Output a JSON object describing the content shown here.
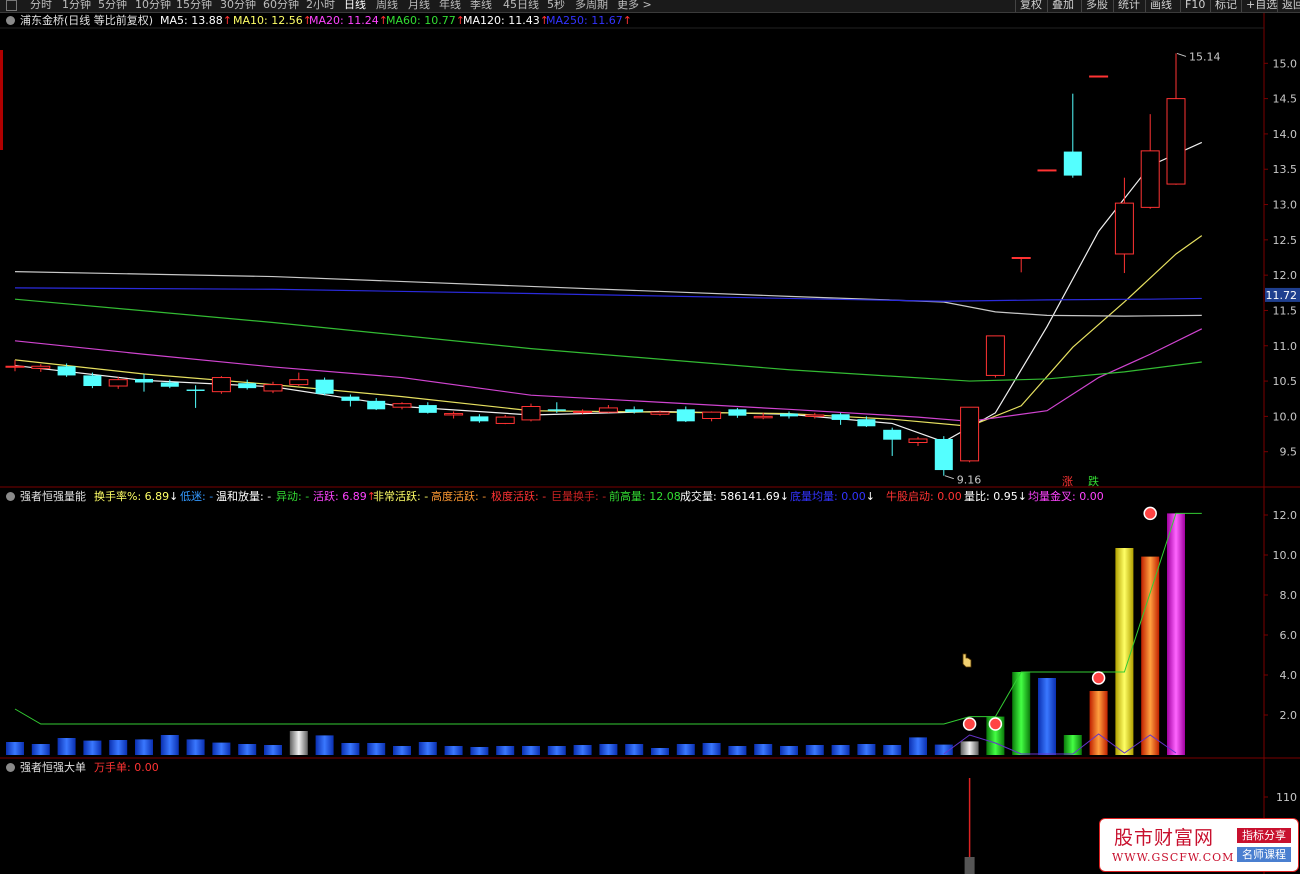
{
  "topbar": {
    "left_items": [
      "分时",
      "1分钟",
      "5分钟",
      "10分钟",
      "15分钟",
      "30分钟",
      "60分钟",
      "2小时",
      "日线",
      "周线",
      "月线",
      "年线",
      "季线",
      "45日线",
      "5秒",
      "多周期",
      "更多 >"
    ],
    "active_index": 8,
    "right_items": [
      "复权",
      "叠加",
      "多股",
      "统计",
      "画线",
      "F10",
      "标记",
      "+自选",
      "返回"
    ]
  },
  "main_legend": {
    "title": "浦东金桥(日线 等比前复权)",
    "items": [
      {
        "label": "MA5: 13.88",
        "arrow": "↑",
        "color": "#ffffff"
      },
      {
        "label": "MA10: 12.56",
        "arrow": "↑",
        "color": "#ffff66"
      },
      {
        "label": "MA20: 11.24",
        "arrow": "↑",
        "color": "#ff44ff"
      },
      {
        "label": "MA60: 10.77",
        "arrow": "↑",
        "color": "#33dd33"
      },
      {
        "label": "MA120: 11.43",
        "arrow": "↑",
        "color": "#ffffff"
      },
      {
        "label": "MA250: 11.67",
        "arrow": "↑",
        "color": "#3333ff"
      }
    ],
    "arrow_color": "#ff3333"
  },
  "vol_legend": {
    "title": "强者恒强量能",
    "items": [
      {
        "label": "换手率%: 6.89",
        "arrow": "↓",
        "color": "#ffff66",
        "arrow_color": "#ffffff"
      },
      {
        "label": "低迷: -",
        "color": "#3399ff"
      },
      {
        "label": "温和放量: -",
        "color": "#ffffff"
      },
      {
        "label": "异动: -",
        "color": "#33dd33"
      },
      {
        "label": "活跃: 6.89",
        "arrow": "↑",
        "color": "#ff44ff",
        "arrow_color": "#ff3333"
      },
      {
        "label": "非常活跃: -",
        "color": "#ffff66"
      },
      {
        "label": "高度活跃: -",
        "color": "#ff9933"
      },
      {
        "label": "极度活跃: -",
        "color": "#ff3333"
      },
      {
        "label": "巨量换手: -",
        "color": "#cc2222"
      },
      {
        "label": "前高量: 12.08",
        "color": "#33dd33"
      },
      {
        "label": "成交量: 586141.69",
        "arrow": "↓",
        "color": "#ffffff",
        "arrow_color": "#ffffff"
      },
      {
        "label": "底量均量: 0.00",
        "arrow": "↓",
        "color": "#3333ff",
        "arrow_color": "#ffffff"
      },
      {
        "label": "牛股启动: 0.00",
        "color": "#ff3333"
      },
      {
        "label": "量比: 0.95",
        "arrow": "↓",
        "color": "#ffffff",
        "arrow_color": "#ffffff"
      },
      {
        "label": "均量金叉: 0.00",
        "color": "#ff44ff"
      }
    ]
  },
  "big_legend": {
    "title": "强者恒强大单",
    "items": [
      {
        "label": "万手单: 0.00",
        "color": "#ff3333"
      }
    ]
  },
  "watermark": {
    "title": "股市财富网",
    "url": "WWW.GSCFW.COM",
    "tag1": "指标分享",
    "tag2": "名师课程"
  },
  "colors": {
    "up": "#ff3333",
    "down": "#54ffff",
    "axis": "#7a0000",
    "grid": "#333333"
  },
  "chart_data": [
    {
      "type": "candlestick",
      "title": "浦东金桥(日线 等比前复权)",
      "ylim": [
        9.0,
        15.5
      ],
      "yticks": [
        9.5,
        10.0,
        10.5,
        11.0,
        11.5,
        12.0,
        12.5,
        13.0,
        13.5,
        14.0,
        14.5,
        15.0
      ],
      "current_price": "11.72",
      "annotations": {
        "high": "15.14",
        "low": "9.16",
        "rise_label": "涨",
        "fall_label": "跌"
      },
      "candles": [
        [
          10.71,
          10.71,
          10.8,
          10.64
        ],
        [
          10.68,
          10.71,
          10.74,
          10.63
        ],
        [
          10.71,
          10.58,
          10.75,
          10.56
        ],
        [
          10.58,
          10.43,
          10.62,
          10.4
        ],
        [
          10.43,
          10.52,
          10.56,
          10.39
        ],
        [
          10.53,
          10.48,
          10.6,
          10.35
        ],
        [
          10.48,
          10.42,
          10.52,
          10.4
        ],
        [
          10.38,
          10.36,
          10.44,
          10.12
        ],
        [
          10.35,
          10.55,
          10.57,
          10.32
        ],
        [
          10.47,
          10.4,
          10.52,
          10.38
        ],
        [
          10.36,
          10.45,
          10.49,
          10.33
        ],
        [
          10.45,
          10.52,
          10.62,
          10.43
        ],
        [
          10.52,
          10.32,
          10.55,
          10.3
        ],
        [
          10.28,
          10.22,
          10.31,
          10.14
        ],
        [
          10.22,
          10.1,
          10.26,
          10.09
        ],
        [
          10.13,
          10.18,
          10.2,
          10.1
        ],
        [
          10.16,
          10.05,
          10.2,
          10.04
        ],
        [
          10.02,
          10.04,
          10.07,
          9.97
        ],
        [
          10.0,
          9.93,
          10.03,
          9.91
        ],
        [
          9.9,
          9.99,
          10.02,
          9.89
        ],
        [
          9.95,
          10.14,
          10.18,
          9.93
        ],
        [
          10.1,
          10.08,
          10.2,
          10.05
        ],
        [
          10.06,
          10.07,
          10.1,
          10.03
        ],
        [
          10.06,
          10.12,
          10.16,
          10.05
        ],
        [
          10.1,
          10.06,
          10.14,
          10.04
        ],
        [
          10.03,
          10.06,
          10.08,
          10.01
        ],
        [
          10.1,
          9.93,
          10.14,
          9.92
        ],
        [
          9.97,
          10.06,
          10.07,
          9.93
        ],
        [
          10.1,
          10.01,
          10.12,
          9.98
        ],
        [
          9.98,
          10.0,
          10.05,
          9.96
        ],
        [
          10.04,
          10.0,
          10.07,
          9.97
        ],
        [
          10.0,
          10.02,
          10.05,
          9.97
        ],
        [
          10.03,
          9.95,
          10.05,
          9.88
        ],
        [
          9.96,
          9.86,
          10.0,
          9.85
        ],
        [
          9.81,
          9.67,
          9.84,
          9.44
        ],
        [
          9.63,
          9.68,
          9.71,
          9.58
        ],
        [
          9.68,
          9.24,
          9.72,
          9.16
        ],
        [
          9.37,
          10.13,
          10.13,
          9.35
        ],
        [
          10.58,
          11.14,
          11.14,
          10.55
        ],
        [
          12.25,
          12.25,
          12.25,
          12.04
        ],
        [
          13.49,
          13.49,
          13.49,
          13.49
        ],
        [
          13.75,
          13.41,
          14.57,
          13.38
        ],
        [
          14.82,
          14.82,
          14.82,
          14.82
        ],
        [
          12.3,
          13.02,
          13.38,
          12.03
        ],
        [
          12.96,
          13.76,
          14.28,
          12.94
        ],
        [
          13.29,
          14.5,
          15.14,
          13.28
        ]
      ],
      "ma": {
        "MA5": [
          [
            0,
            10.72
          ],
          [
            5,
            10.51
          ],
          [
            10,
            10.42
          ],
          [
            15,
            10.14
          ],
          [
            20,
            10.02
          ],
          [
            25,
            10.07
          ],
          [
            30,
            10.03
          ],
          [
            34,
            9.9
          ],
          [
            36,
            9.64
          ],
          [
            38,
            10.05
          ],
          [
            40,
            11.27
          ],
          [
            42,
            12.62
          ],
          [
            44,
            13.55
          ],
          [
            46,
            13.88
          ]
        ],
        "MA10": [
          [
            0,
            10.8
          ],
          [
            5,
            10.6
          ],
          [
            10,
            10.45
          ],
          [
            15,
            10.28
          ],
          [
            20,
            10.08
          ],
          [
            25,
            10.06
          ],
          [
            30,
            10.04
          ],
          [
            34,
            9.96
          ],
          [
            37,
            9.86
          ],
          [
            39,
            10.15
          ],
          [
            41,
            10.98
          ],
          [
            43,
            11.62
          ],
          [
            45,
            12.3
          ],
          [
            46,
            12.56
          ]
        ],
        "MA20": [
          [
            0,
            11.07
          ],
          [
            5,
            10.88
          ],
          [
            10,
            10.7
          ],
          [
            15,
            10.55
          ],
          [
            20,
            10.3
          ],
          [
            25,
            10.2
          ],
          [
            30,
            10.1
          ],
          [
            35,
            9.99
          ],
          [
            37,
            9.93
          ],
          [
            40,
            10.08
          ],
          [
            42,
            10.55
          ],
          [
            44,
            10.88
          ],
          [
            46,
            11.24
          ]
        ],
        "MA60": [
          [
            0,
            11.66
          ],
          [
            10,
            11.33
          ],
          [
            20,
            10.96
          ],
          [
            30,
            10.66
          ],
          [
            37,
            10.5
          ],
          [
            40,
            10.53
          ],
          [
            43,
            10.63
          ],
          [
            46,
            10.77
          ]
        ],
        "MA120": [
          [
            0,
            12.05
          ],
          [
            10,
            11.98
          ],
          [
            20,
            11.84
          ],
          [
            30,
            11.7
          ],
          [
            36,
            11.62
          ],
          [
            38,
            11.48
          ],
          [
            40,
            11.43
          ],
          [
            43,
            11.42
          ],
          [
            46,
            11.43
          ]
        ],
        "MA250": [
          [
            0,
            11.82
          ],
          [
            10,
            11.8
          ],
          [
            20,
            11.74
          ],
          [
            30,
            11.67
          ],
          [
            36,
            11.63
          ],
          [
            40,
            11.65
          ],
          [
            44,
            11.66
          ],
          [
            46,
            11.67
          ]
        ]
      }
    },
    {
      "type": "bar",
      "title": "强者恒强量能",
      "ylim": [
        0,
        12.5
      ],
      "yticks": [
        2.0,
        4.0,
        6.0,
        8.0,
        10.0,
        12.0
      ],
      "values": [
        0.65,
        0.55,
        0.85,
        0.72,
        0.75,
        0.78,
        1.0,
        0.78,
        0.62,
        0.55,
        0.5,
        1.2,
        0.98,
        0.6,
        0.6,
        0.45,
        0.65,
        0.45,
        0.4,
        0.45,
        0.45,
        0.45,
        0.5,
        0.55,
        0.55,
        0.35,
        0.55,
        0.6,
        0.45,
        0.55,
        0.45,
        0.5,
        0.5,
        0.55,
        0.5,
        0.88,
        0.52,
        0.68,
        1.92,
        4.15,
        3.85,
        1.0,
        3.2,
        10.35,
        9.92,
        12.08,
        6.89
      ],
      "bar_colors": [
        "blue",
        "blue",
        "blue",
        "blue",
        "blue",
        "blue",
        "blue",
        "blue",
        "blue",
        "blue",
        "blue",
        "grey",
        "blue",
        "blue",
        "blue",
        "blue",
        "blue",
        "blue",
        "blue",
        "blue",
        "blue",
        "blue",
        "blue",
        "blue",
        "blue",
        "blue",
        "blue",
        "blue",
        "blue",
        "blue",
        "blue",
        "blue",
        "blue",
        "blue",
        "blue",
        "blue",
        "blue",
        "grey",
        "green",
        "green",
        "blue",
        "green",
        "orange",
        "yellow",
        "orange",
        "magenta"
      ],
      "front_high_line": [
        [
          0,
          2.3
        ],
        [
          1,
          1.55
        ],
        [
          36,
          1.55
        ],
        [
          37,
          1.92
        ],
        [
          38,
          1.92
        ],
        [
          39,
          4.15
        ],
        [
          43,
          4.15
        ],
        [
          45,
          12.08
        ],
        [
          46,
          12.08
        ]
      ],
      "markers": [
        37,
        38,
        42,
        44
      ]
    },
    {
      "type": "bar",
      "title": "强者恒强大单",
      "yticks": [
        110
      ],
      "spike_index": 37
    }
  ]
}
